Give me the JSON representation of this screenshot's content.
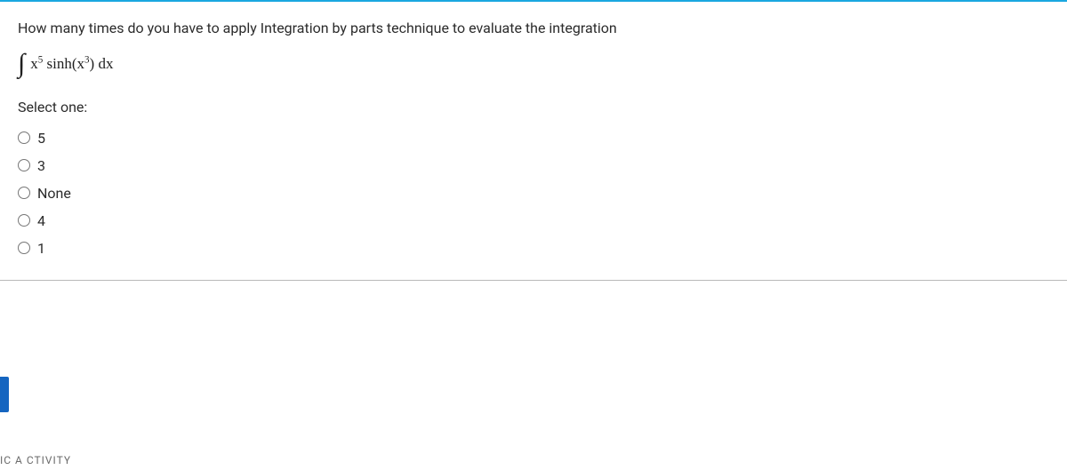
{
  "question": {
    "prompt_text": "How many times do you have to apply  Integration by parts technique to evaluate the integration",
    "formula": {
      "prefix": "∫",
      "xpow": "5",
      "func": "sinh(",
      "argbase": "x",
      "argpow": "3",
      "suffix": ") dx"
    }
  },
  "select_label": "Select one:",
  "options": [
    {
      "label": "5"
    },
    {
      "label": "3"
    },
    {
      "label": "None"
    },
    {
      "label": "4"
    },
    {
      "label": "1"
    }
  ],
  "footer_fragment": "IC  A CTIVITY"
}
